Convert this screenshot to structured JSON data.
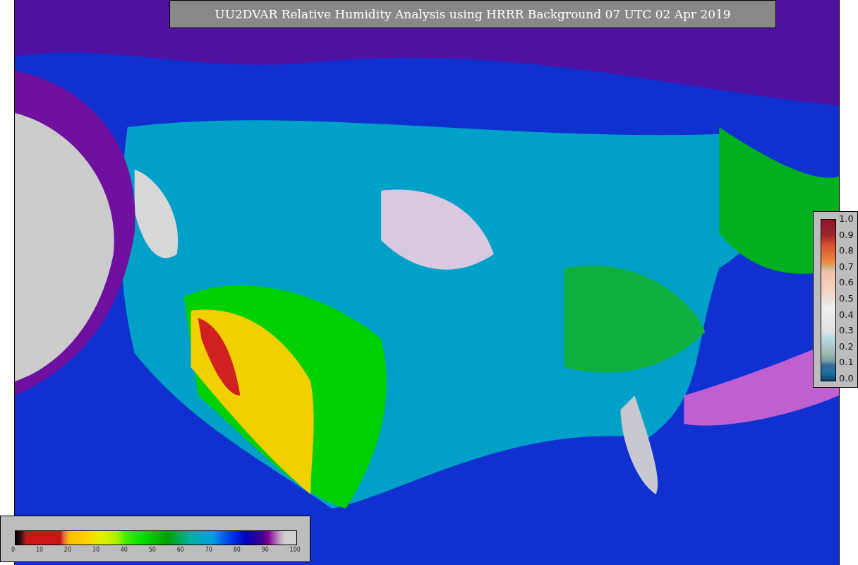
{
  "title": "UU2DVAR Relative Humidity Analysis using HRRR Background 07 UTC 02 Apr 2019",
  "humidity_colorbar": {
    "ticks": [
      "0",
      "10",
      "20",
      "30",
      "40",
      "50",
      "60",
      "70",
      "80",
      "90",
      "100"
    ]
  },
  "fraction_colorbar": {
    "ticks": [
      "1.0",
      "0.9",
      "0.8",
      "0.7",
      "0.6",
      "0.5",
      "0.4",
      "0.3",
      "0.2",
      "0.1",
      "0.0"
    ]
  }
}
